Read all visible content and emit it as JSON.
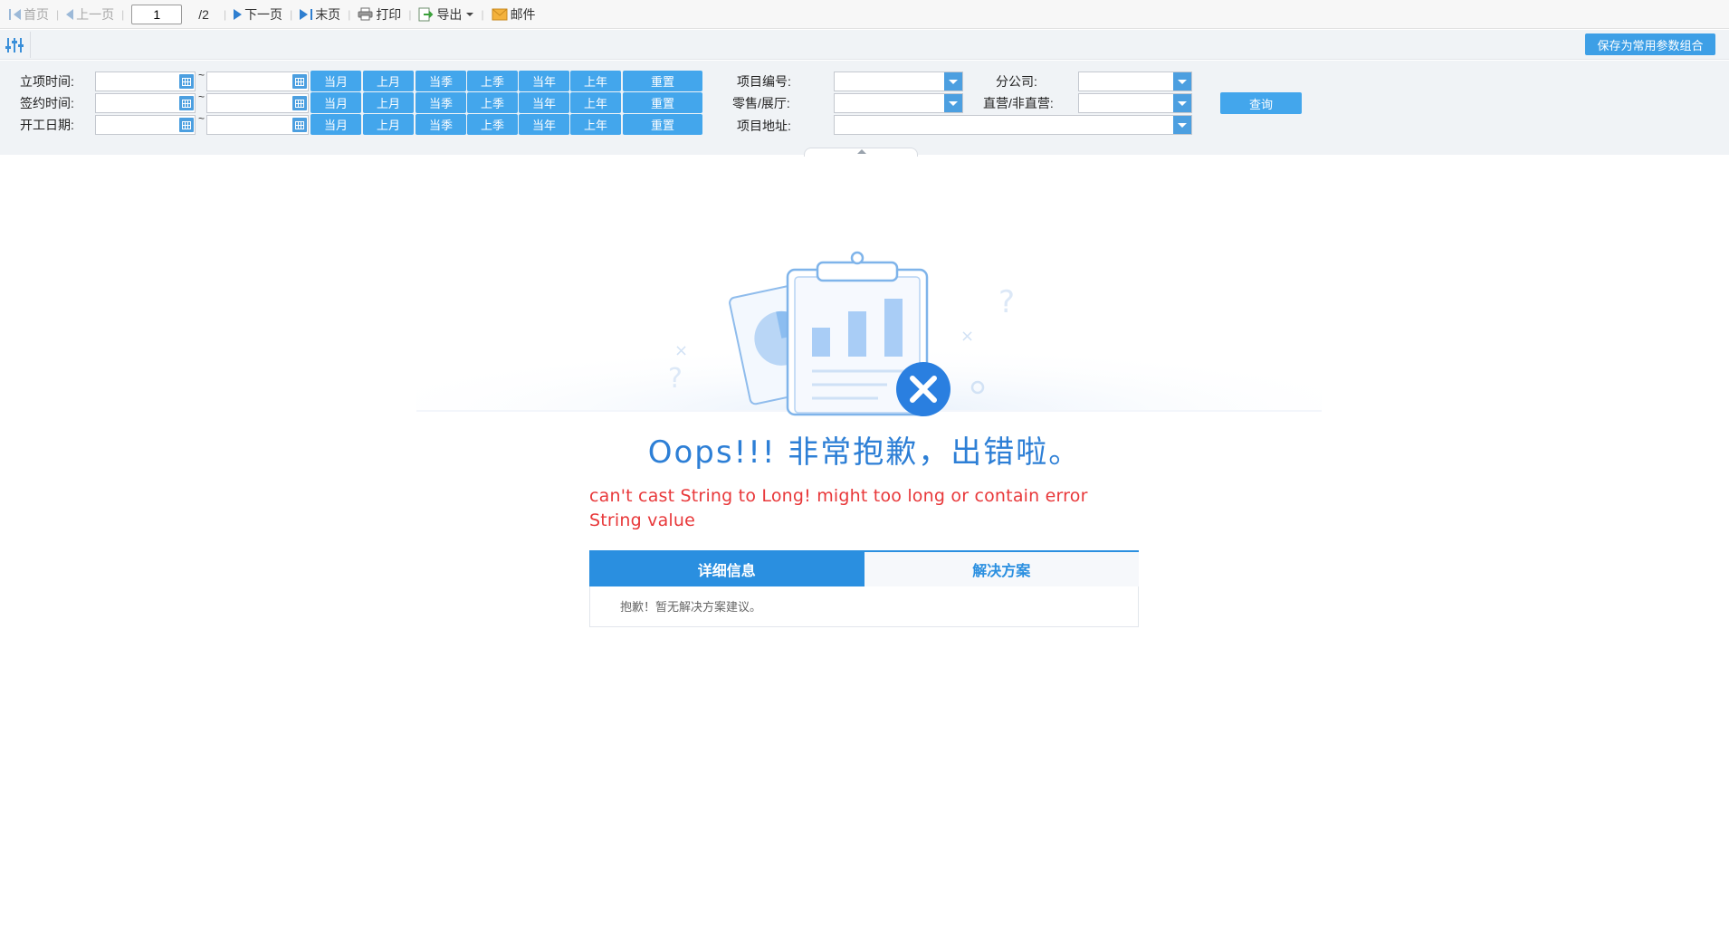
{
  "toolbar": {
    "first": "首页",
    "prev": "上一页",
    "page_value": "1",
    "page_total": "/2",
    "next": "下一页",
    "last": "末页",
    "print": "打印",
    "export": "导出",
    "mail": "邮件"
  },
  "param_bar": {
    "save_combo": "保存为常用参数组合"
  },
  "filters": {
    "rows": [
      {
        "label": "立项时间:",
        "tilde": "~",
        "buttons": [
          "当月",
          "上月",
          "当季",
          "上季",
          "当年",
          "上年",
          "重置"
        ]
      },
      {
        "label": "签约时间:",
        "tilde": "~",
        "buttons": [
          "当月",
          "上月",
          "当季",
          "上季",
          "当年",
          "上年",
          "重置"
        ]
      },
      {
        "label": "开工日期:",
        "tilde": "~",
        "buttons": [
          "当月",
          "上月",
          "当季",
          "上季",
          "当年",
          "上年",
          "重置"
        ]
      }
    ],
    "project_no_label": "项目编号:",
    "retail_label": "零售/展厅:",
    "address_label": "项目地址:",
    "branch_label": "分公司:",
    "direct_label": "直营/非直营:",
    "query": "查询"
  },
  "error": {
    "title": "Oops!!! 非常抱歉，出错啦。",
    "message": "can't cast String to Long! might too long or contain error String value",
    "tabs": [
      "详细信息",
      "解决方案"
    ],
    "content": "抱歉！暂无解决方案建议。"
  },
  "colors": {
    "accent": "#43a6ec",
    "title": "#2d7fd6",
    "error": "#e8383a",
    "icon_close": "#2a7fe0"
  }
}
